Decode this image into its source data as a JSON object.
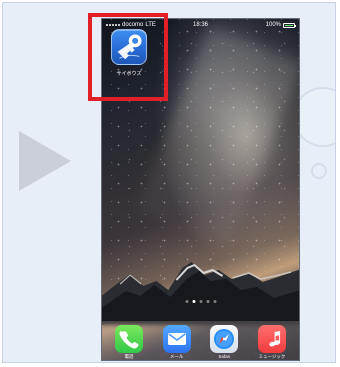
{
  "status_bar": {
    "carrier": "docomo",
    "network": "LTE",
    "time": "18:36",
    "battery_percent": "100%"
  },
  "home_screen": {
    "featured_app": {
      "label": "サイボウズ"
    },
    "page_indicator": {
      "total": 5,
      "active_index": 1
    },
    "dock": {
      "items": [
        {
          "label": "電話",
          "icon": "phone-icon"
        },
        {
          "label": "メール",
          "icon": "mail-icon"
        },
        {
          "label": "Safari",
          "icon": "safari-icon"
        },
        {
          "label": "ミュージック",
          "icon": "music-icon"
        }
      ]
    }
  },
  "annotation": {
    "highlight_color": "#e11f26"
  }
}
